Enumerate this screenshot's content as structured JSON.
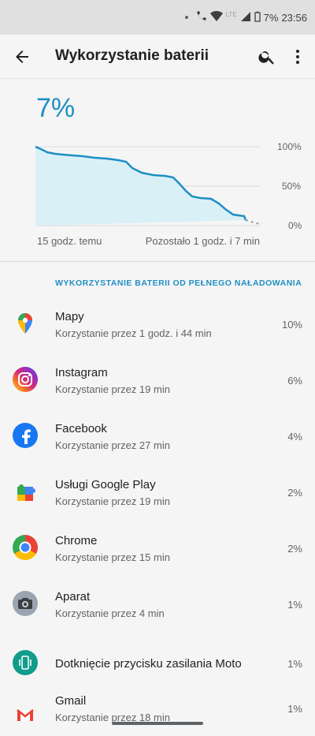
{
  "status": {
    "battery": "7%",
    "time": "23:56",
    "network": "LTE"
  },
  "appbar": {
    "title": "Wykorzystanie baterii"
  },
  "battery": {
    "percent": "7%",
    "time_ago": "15 godz. temu",
    "remaining": "Pozostało 1 godz. i 7 min",
    "axis": {
      "y100": "100%",
      "y50": "50%",
      "y0": "0%"
    }
  },
  "section": {
    "title": "WYKORZYSTANIE BATERII OD PEŁNEGO NAŁADOWANIA"
  },
  "apps": [
    {
      "name": "Mapy",
      "usage": "Korzystanie przez 1 godz. i 44 min",
      "value": "10%",
      "icon": "maps-icon"
    },
    {
      "name": "Instagram",
      "usage": "Korzystanie przez 19 min",
      "value": "6%",
      "icon": "instagram-icon"
    },
    {
      "name": "Facebook",
      "usage": "Korzystanie przez 27 min",
      "value": "4%",
      "icon": "facebook-icon"
    },
    {
      "name": "Usługi Google Play",
      "usage": "Korzystanie przez 19 min",
      "value": "2%",
      "icon": "google-play-services-icon"
    },
    {
      "name": "Chrome",
      "usage": "Korzystanie przez 15 min",
      "value": "2%",
      "icon": "chrome-icon"
    },
    {
      "name": "Aparat",
      "usage": "Korzystanie przez 4 min",
      "value": "1%",
      "icon": "camera-icon"
    },
    {
      "name": "Dotknięcie przycisku zasilania Moto",
      "usage": "",
      "value": "1%",
      "icon": "moto-power-touch-icon"
    },
    {
      "name": "Gmail",
      "usage": "Korzystanie przez 18 min",
      "value": "1%",
      "icon": "gmail-icon"
    }
  ],
  "colors": {
    "accent": "#1e8fc4",
    "chart_fill": "#d9f0f7"
  }
}
